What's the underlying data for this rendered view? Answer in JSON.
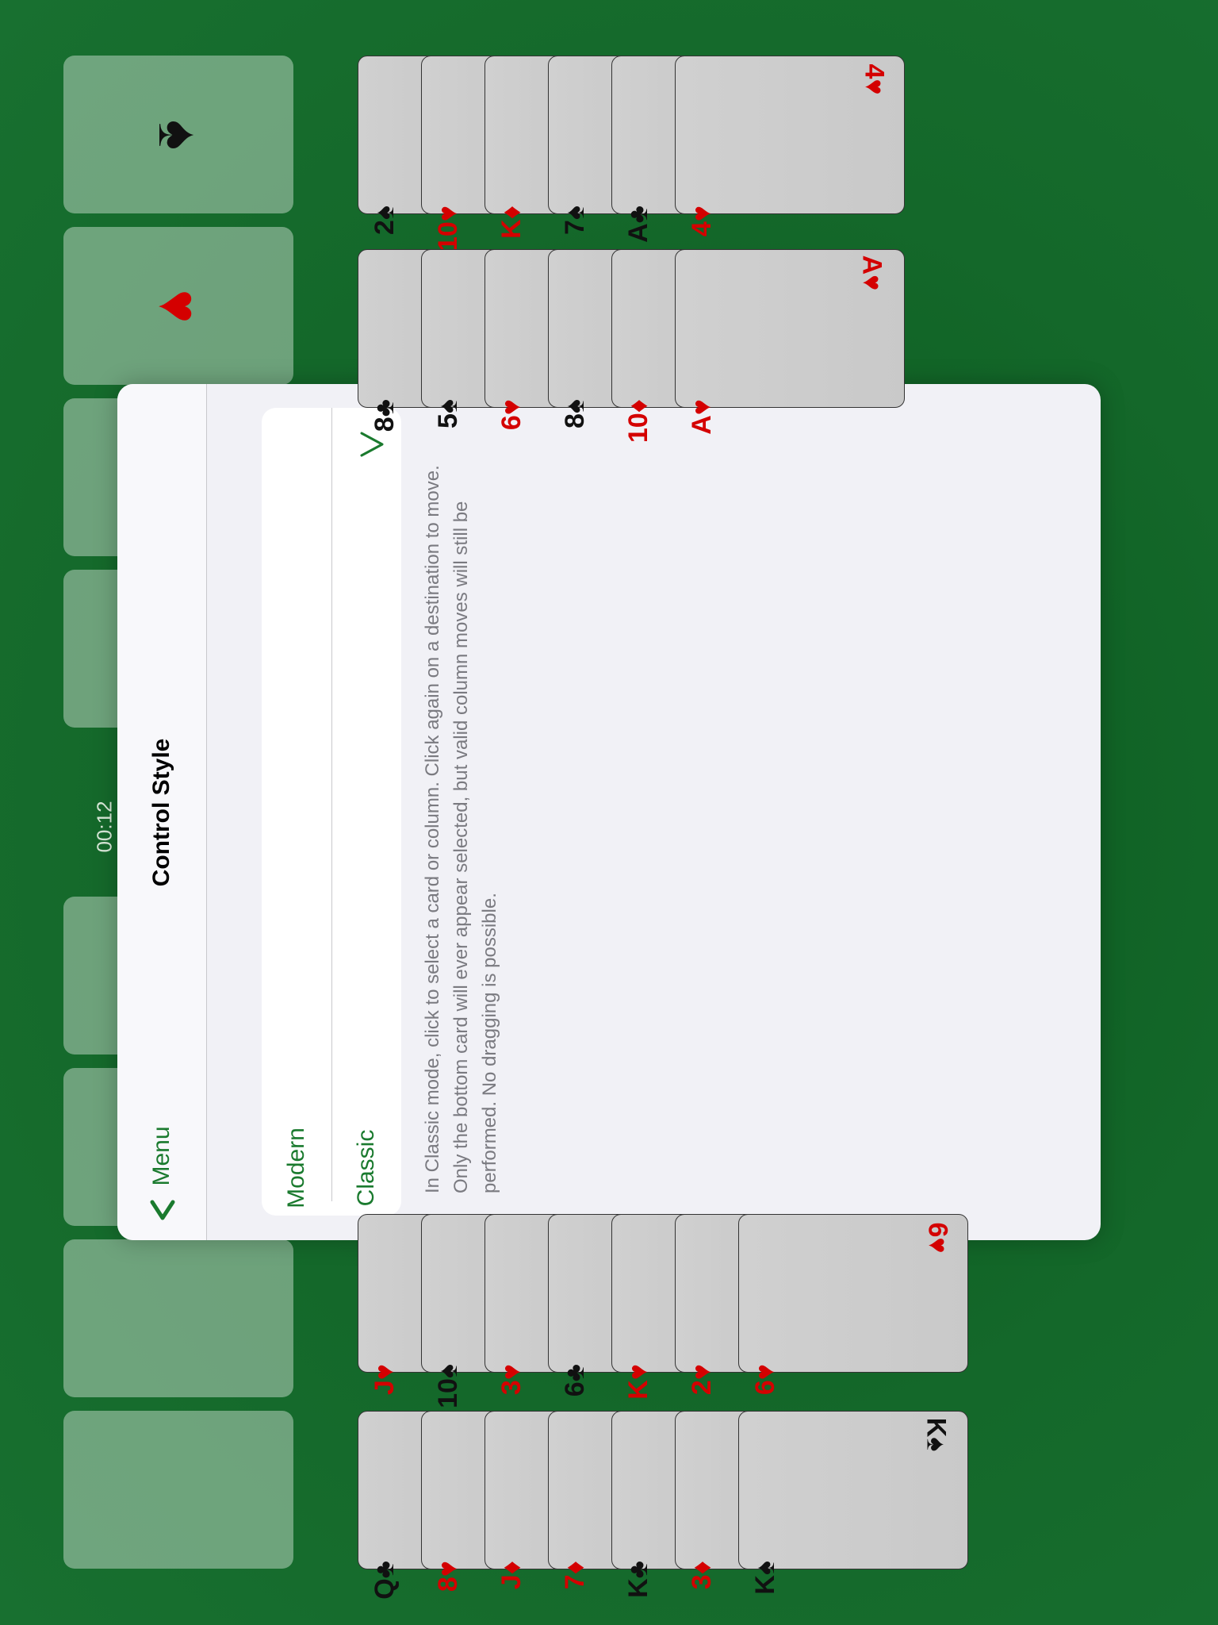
{
  "timer": "00:12",
  "foundations": [
    {
      "suit": "♠",
      "color": "#111"
    },
    {
      "suit": "♥",
      "color": "#d40000"
    },
    {
      "suit": "",
      "color": ""
    },
    {
      "suit": "",
      "color": ""
    }
  ],
  "free_cells": [
    "",
    "",
    "",
    ""
  ],
  "tableau": {
    "column1": [
      {
        "rank": "2",
        "suit": "♠",
        "color": "black"
      },
      {
        "rank": "10",
        "suit": "♥",
        "color": "red"
      },
      {
        "rank": "K",
        "suit": "♦",
        "color": "red"
      },
      {
        "rank": "7",
        "suit": "♠",
        "color": "black"
      },
      {
        "rank": "A",
        "suit": "♣",
        "color": "black"
      },
      {
        "rank": "4",
        "suit": "♥",
        "color": "red"
      }
    ],
    "column2": [
      {
        "rank": "8",
        "suit": "♣",
        "color": "black"
      },
      {
        "rank": "5",
        "suit": "♠",
        "color": "black"
      },
      {
        "rank": "6",
        "suit": "♥",
        "color": "red"
      },
      {
        "rank": "8",
        "suit": "♠",
        "color": "black"
      },
      {
        "rank": "10",
        "suit": "♦",
        "color": "red"
      },
      {
        "rank": "A",
        "suit": "♥",
        "color": "red"
      }
    ],
    "column7": [
      {
        "rank": "J",
        "suit": "♥",
        "color": "red"
      },
      {
        "rank": "10",
        "suit": "♠",
        "color": "black"
      },
      {
        "rank": "3",
        "suit": "♥",
        "color": "red"
      },
      {
        "rank": "6",
        "suit": "♣",
        "color": "black"
      },
      {
        "rank": "K",
        "suit": "♥",
        "color": "red"
      },
      {
        "rank": "2",
        "suit": "♥",
        "color": "red"
      },
      {
        "rank": "6",
        "suit": "♥",
        "color": "red"
      }
    ],
    "column8": [
      {
        "rank": "Q",
        "suit": "♣",
        "color": "black"
      },
      {
        "rank": "8",
        "suit": "♥",
        "color": "red"
      },
      {
        "rank": "J",
        "suit": "♦",
        "color": "red"
      },
      {
        "rank": "7",
        "suit": "♦",
        "color": "red"
      },
      {
        "rank": "K",
        "suit": "♣",
        "color": "black"
      },
      {
        "rank": "3",
        "suit": "♦",
        "color": "red"
      },
      {
        "rank": "K",
        "suit": "♠",
        "color": "black"
      }
    ]
  },
  "modal": {
    "title": "Control Style",
    "back_label": "Menu",
    "options": [
      {
        "label": "Modern",
        "selected": false
      },
      {
        "label": "Classic",
        "selected": true
      }
    ],
    "note": "In Classic mode, click to select a card or column. Click again on a destination to move. Only the bottom card will ever appear selected, but valid column moves will still be performed. No dragging is possible."
  },
  "colors": {
    "accent": "#1a7a2e",
    "felt": "#14682a",
    "red_suit": "#d40000"
  }
}
